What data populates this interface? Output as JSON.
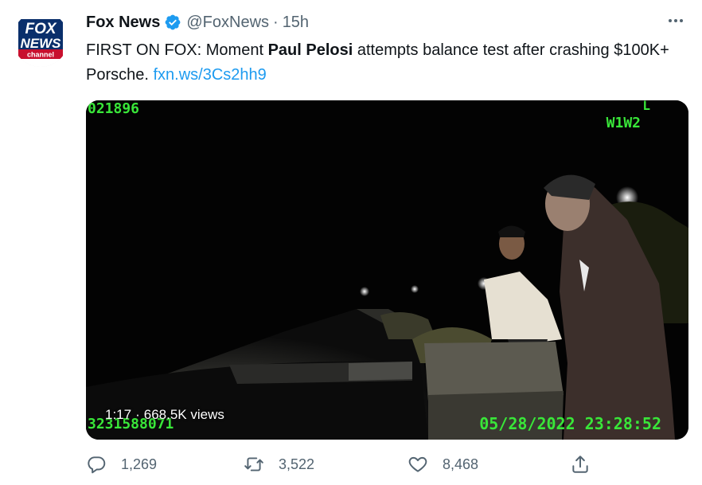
{
  "tweet": {
    "author_name": "Fox News",
    "author_handle": "@FoxNews",
    "separator": "·",
    "time": "15h",
    "text_prefix": "FIRST ON FOX: Moment ",
    "text_bold": "Paul Pelosi",
    "text_suffix": " attempts balance test after crashing $100K+ Porsche. ",
    "link_text": "fxn.ws/3Cs2hh9"
  },
  "avatar": {
    "logo_line1": "FOX",
    "logo_line2": "NEWS",
    "logo_line3": "channel"
  },
  "video": {
    "osd_top_left": "021896",
    "osd_top_right": "W1W2",
    "osd_top_right_mark": "L",
    "osd_bottom_left": "3231588071",
    "osd_timestamp": "05/28/2022 23:28:52",
    "duration": "1:17",
    "views": "668.5K views"
  },
  "actions": {
    "replies": "1,269",
    "retweets": "3,522",
    "likes": "8,468"
  },
  "colors": {
    "accent": "#1d9bf0",
    "secondary_text": "#536471",
    "osd_green": "#39e639"
  },
  "icons": [
    "fox-news-logo-icon",
    "verified-badge-icon",
    "more-options-icon",
    "reply-icon",
    "retweet-icon",
    "like-icon",
    "share-icon"
  ]
}
